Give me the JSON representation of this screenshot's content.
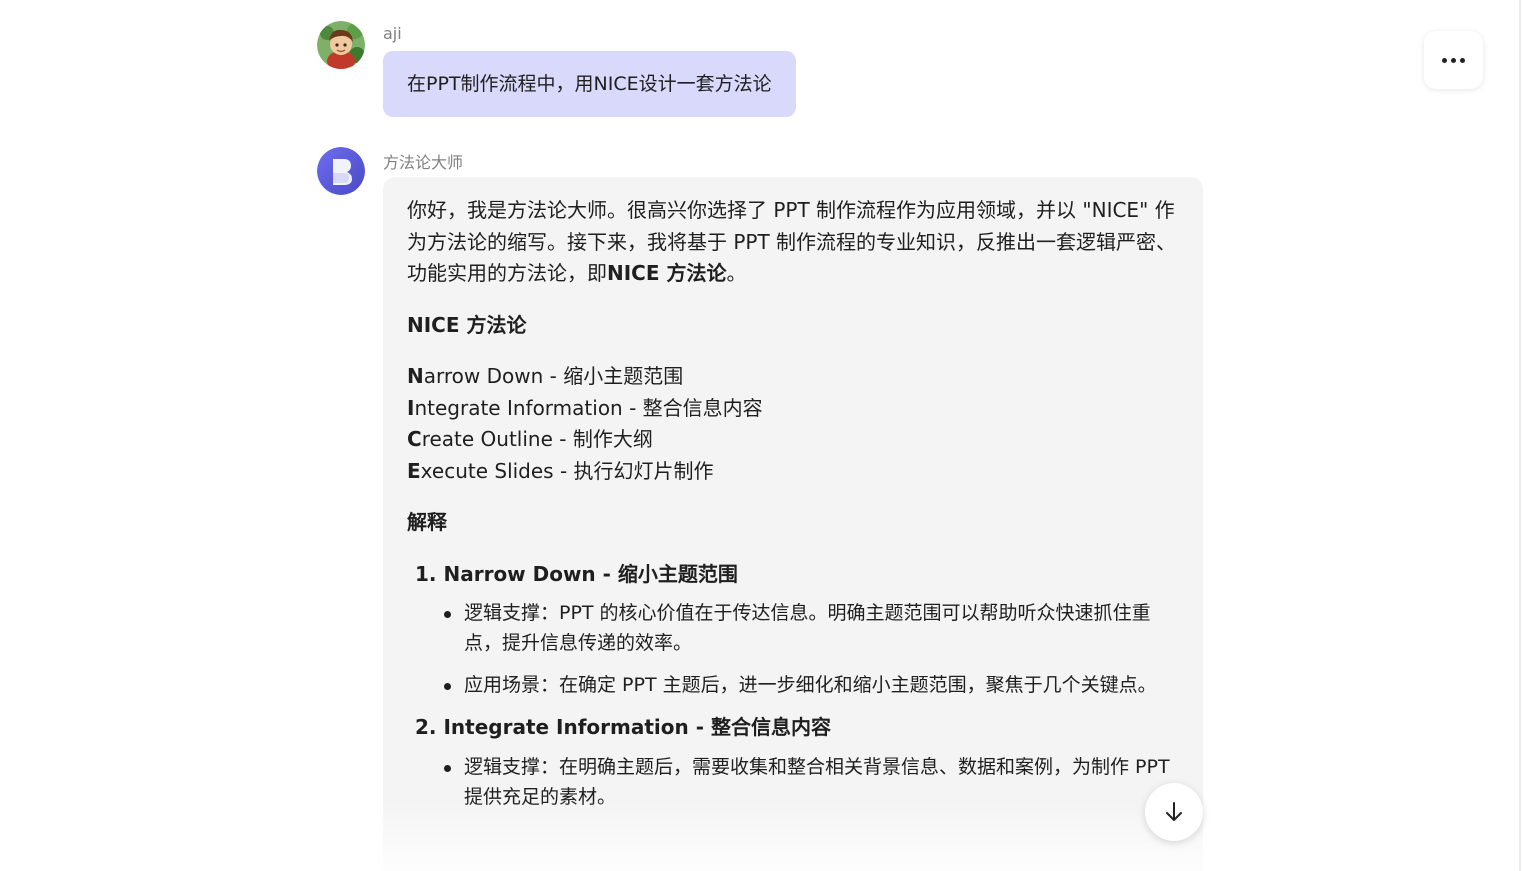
{
  "header": {
    "more_icon": "more-horizontal-icon"
  },
  "messages": {
    "user": {
      "name": "aji",
      "avatar_icon": "user-cartoon-avatar-icon",
      "text": "在PPT制作流程中，用NICE设计一套方法论"
    },
    "bot": {
      "name": "方法论大师",
      "avatar_icon": "bot-logo-avatar-icon",
      "avatar_color": "#5b5bd6",
      "intro": "你好，我是方法论大师。很高兴你选择了 PPT 制作流程作为应用领域，并以 \"NICE\" 作为方法论的缩写。接下来，我将基于 PPT 制作流程的专业知识，反推出一套逻辑严密、功能实用的方法论，即",
      "intro_bold": "NICE 方法论",
      "intro_end": "。",
      "section_title": "NICE 方法论",
      "nice_items": [
        {
          "letter": "N",
          "rest": "arrow Down - 缩小主题范围"
        },
        {
          "letter": "I",
          "rest": "ntegrate Information - 整合信息内容"
        },
        {
          "letter": "C",
          "rest": "reate Outline - 制作大纲"
        },
        {
          "letter": "E",
          "rest": "xecute Slides - 执行幻灯片制作"
        }
      ],
      "explain_title": "解释",
      "details": [
        {
          "heading": "1. Narrow Down - 缩小主题范围",
          "bullets": [
            "逻辑支撑：PPT 的核心价值在于传达信息。明确主题范围可以帮助听众快速抓住重点，提升信息传递的效率。",
            "应用场景：在确定 PPT 主题后，进一步细化和缩小主题范围，聚焦于几个关键点。"
          ]
        },
        {
          "heading": "2. Integrate Information - 整合信息内容",
          "bullets": [
            "逻辑支撑：在明确主题后，需要收集和整合相关背景信息、数据和案例，为制作 PPT 提供充足的素材。"
          ]
        }
      ]
    }
  },
  "scroll_button": {
    "icon": "arrow-down-icon"
  },
  "colors": {
    "user_bubble": "#d8d9fb",
    "bot_bubble": "#f4f4f4"
  }
}
